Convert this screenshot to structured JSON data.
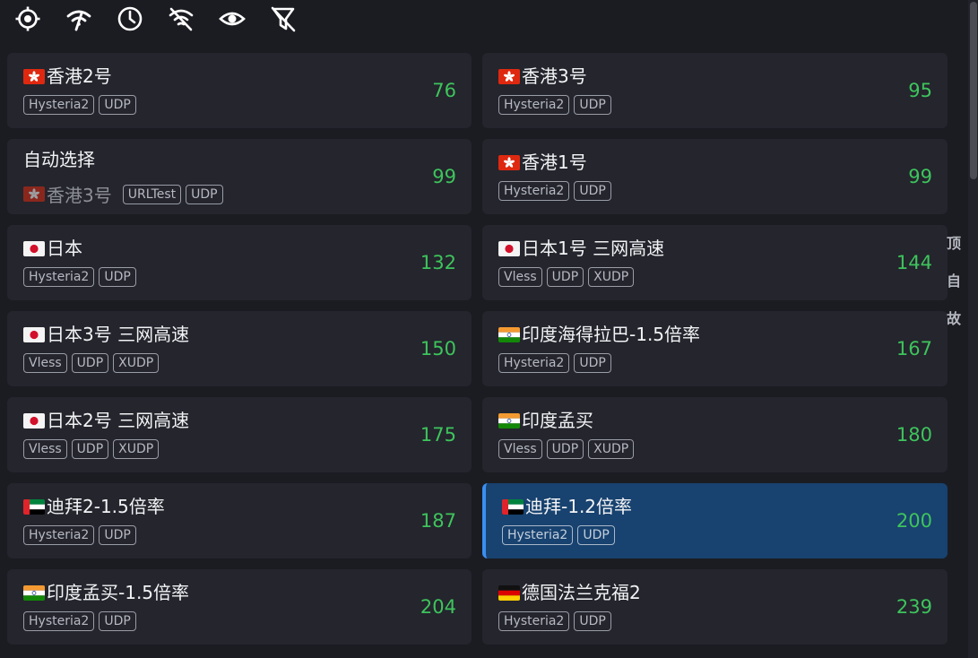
{
  "toolbar": {
    "icons": [
      "locate-icon",
      "signal-icon",
      "clock-icon",
      "no-signal-icon",
      "eye-icon",
      "filter-off-icon"
    ]
  },
  "side_actions": [
    "顶",
    "自",
    "故"
  ],
  "proxies": [
    {
      "flag": "hk",
      "name": "香港2号",
      "tags": [
        "Hysteria2",
        "UDP"
      ],
      "delay": "76",
      "active": false
    },
    {
      "flag": "hk",
      "name": "香港3号",
      "tags": [
        "Hysteria2",
        "UDP"
      ],
      "delay": "95",
      "active": false
    },
    {
      "flag": "",
      "name": "自动选择",
      "sub_flag": "hk",
      "sub_name": "香港3号",
      "tags": [
        "URLTest",
        "UDP"
      ],
      "delay": "99",
      "active": false
    },
    {
      "flag": "hk",
      "name": "香港1号",
      "tags": [
        "Hysteria2",
        "UDP"
      ],
      "delay": "99",
      "active": false
    },
    {
      "flag": "jp",
      "name": "日本",
      "tags": [
        "Hysteria2",
        "UDP"
      ],
      "delay": "132",
      "active": false
    },
    {
      "flag": "jp",
      "name": "日本1号 三网高速",
      "tags": [
        "Vless",
        "UDP",
        "XUDP"
      ],
      "delay": "144",
      "active": false
    },
    {
      "flag": "jp",
      "name": "日本3号 三网高速",
      "tags": [
        "Vless",
        "UDP",
        "XUDP"
      ],
      "delay": "150",
      "active": false
    },
    {
      "flag": "in",
      "name": "印度海得拉巴-1.5倍率",
      "tags": [
        "Hysteria2",
        "UDP"
      ],
      "delay": "167",
      "active": false
    },
    {
      "flag": "jp",
      "name": "日本2号 三网高速",
      "tags": [
        "Vless",
        "UDP",
        "XUDP"
      ],
      "delay": "175",
      "active": false
    },
    {
      "flag": "in",
      "name": "印度孟买",
      "tags": [
        "Vless",
        "UDP",
        "XUDP"
      ],
      "delay": "180",
      "active": false
    },
    {
      "flag": "ae",
      "name": "迪拜2-1.5倍率",
      "tags": [
        "Hysteria2",
        "UDP"
      ],
      "delay": "187",
      "active": false
    },
    {
      "flag": "ae",
      "name": "迪拜-1.2倍率",
      "tags": [
        "Hysteria2",
        "UDP"
      ],
      "delay": "200",
      "active": true
    },
    {
      "flag": "in",
      "name": "印度孟买-1.5倍率",
      "tags": [
        "Hysteria2",
        "UDP"
      ],
      "delay": "204",
      "active": false
    },
    {
      "flag": "de",
      "name": "德国法兰克福2",
      "tags": [
        "Hysteria2",
        "UDP"
      ],
      "delay": "239",
      "active": false
    }
  ],
  "colors": {
    "background": "#1b1c22",
    "card": "#24252d",
    "active_card": "#18426f",
    "active_border": "#3a8ff0",
    "delay_green": "#3ec45c"
  }
}
